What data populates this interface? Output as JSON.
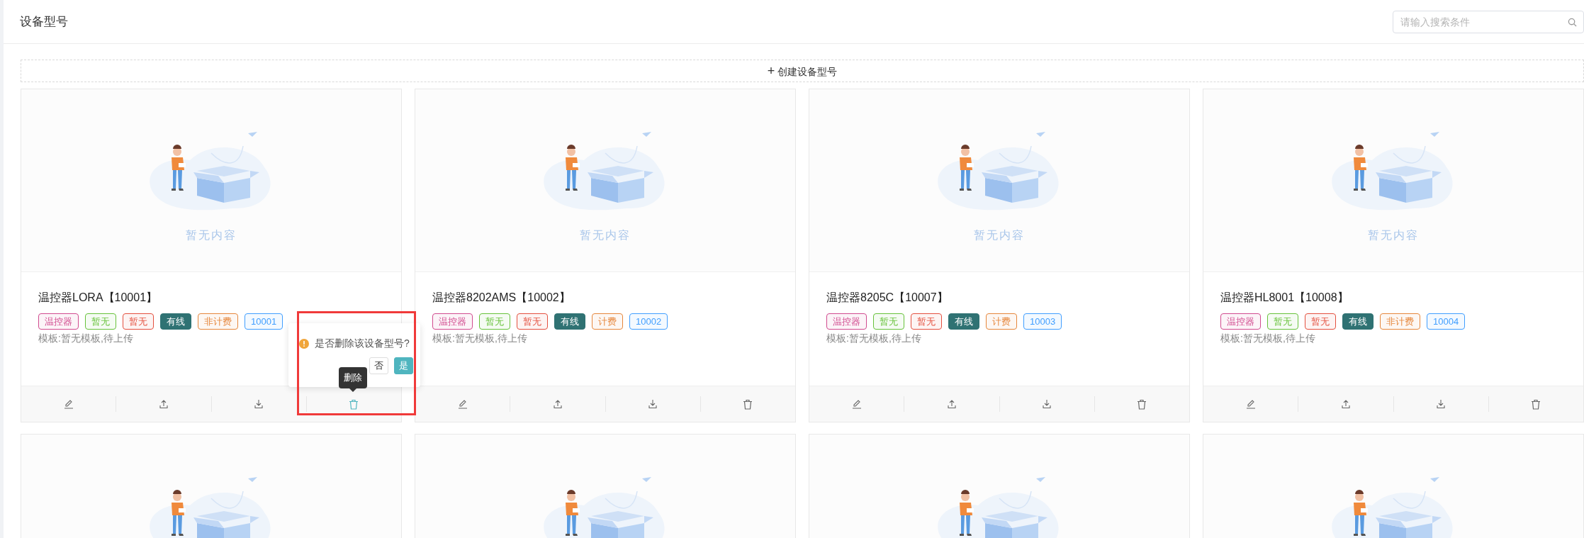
{
  "header": {
    "title": "设备型号",
    "search": {
      "placeholder": "请输入搜索条件"
    }
  },
  "create_button": {
    "icon": "+",
    "label": "创建设备型号"
  },
  "cards": [
    {
      "kind": "full",
      "empty_text": "暂无内容",
      "title": "温控器LORA【10001】",
      "tags": [
        {
          "text": "温控器",
          "kind": "outline",
          "color": "#d14b8f"
        },
        {
          "text": "暂无",
          "kind": "outline",
          "color": "#67c23a"
        },
        {
          "text": "暂无",
          "kind": "outline",
          "color": "#e4503f"
        },
        {
          "text": "有线",
          "kind": "filled",
          "color": "#2f7273"
        },
        {
          "text": "非计费",
          "kind": "outline",
          "color": "#e6873c"
        },
        {
          "text": "10001",
          "kind": "outline",
          "color": "#409eff"
        }
      ],
      "template": "模板:暂无模板,待上传",
      "actions": [
        {
          "kind": "edit",
          "hovered": false
        },
        {
          "kind": "upload",
          "hovered": false
        },
        {
          "kind": "download",
          "hovered": false
        },
        {
          "kind": "delete",
          "hovered": true
        }
      ]
    },
    {
      "kind": "full",
      "empty_text": "暂无内容",
      "title": "温控器8202AMS【10002】",
      "tags": [
        {
          "text": "温控器",
          "kind": "outline",
          "color": "#d14b8f"
        },
        {
          "text": "暂无",
          "kind": "outline",
          "color": "#67c23a"
        },
        {
          "text": "暂无",
          "kind": "outline",
          "color": "#e4503f"
        },
        {
          "text": "有线",
          "kind": "filled",
          "color": "#2f7273"
        },
        {
          "text": "计费",
          "kind": "outline",
          "color": "#e6873c"
        },
        {
          "text": "10002",
          "kind": "outline",
          "color": "#409eff"
        }
      ],
      "template": "模板:暂无模板,待上传",
      "actions": [
        {
          "kind": "edit",
          "hovered": false
        },
        {
          "kind": "upload",
          "hovered": false
        },
        {
          "kind": "download",
          "hovered": false
        },
        {
          "kind": "delete",
          "hovered": false
        }
      ]
    },
    {
      "kind": "full",
      "empty_text": "暂无内容",
      "title": "温控器8205C【10007】",
      "tags": [
        {
          "text": "温控器",
          "kind": "outline",
          "color": "#d14b8f"
        },
        {
          "text": "暂无",
          "kind": "outline",
          "color": "#67c23a"
        },
        {
          "text": "暂无",
          "kind": "outline",
          "color": "#e4503f"
        },
        {
          "text": "有线",
          "kind": "filled",
          "color": "#2f7273"
        },
        {
          "text": "计费",
          "kind": "outline",
          "color": "#e6873c"
        },
        {
          "text": "10003",
          "kind": "outline",
          "color": "#409eff"
        }
      ],
      "template": "模板:暂无模板,待上传",
      "actions": [
        {
          "kind": "edit",
          "hovered": false
        },
        {
          "kind": "upload",
          "hovered": false
        },
        {
          "kind": "download",
          "hovered": false
        },
        {
          "kind": "delete",
          "hovered": false
        }
      ]
    },
    {
      "kind": "full",
      "empty_text": "暂无内容",
      "title": "温控器HL8001【10008】",
      "tags": [
        {
          "text": "温控器",
          "kind": "outline",
          "color": "#d14b8f"
        },
        {
          "text": "暂无",
          "kind": "outline",
          "color": "#67c23a"
        },
        {
          "text": "暂无",
          "kind": "outline",
          "color": "#e4503f"
        },
        {
          "text": "有线",
          "kind": "filled",
          "color": "#2f7273"
        },
        {
          "text": "非计费",
          "kind": "outline",
          "color": "#e6873c"
        },
        {
          "text": "10004",
          "kind": "outline",
          "color": "#409eff"
        }
      ],
      "template": "模板:暂无模板,待上传",
      "actions": [
        {
          "kind": "edit",
          "hovered": false
        },
        {
          "kind": "upload",
          "hovered": false
        },
        {
          "kind": "download",
          "hovered": false
        },
        {
          "kind": "delete",
          "hovered": false
        }
      ]
    },
    {
      "kind": "cut"
    },
    {
      "kind": "cut"
    },
    {
      "kind": "cut"
    },
    {
      "kind": "cut"
    }
  ],
  "popconfirm": {
    "message": "是否删除该设备型号?",
    "cancel": "否",
    "confirm": "是"
  },
  "tooltip": {
    "text": "删除"
  }
}
